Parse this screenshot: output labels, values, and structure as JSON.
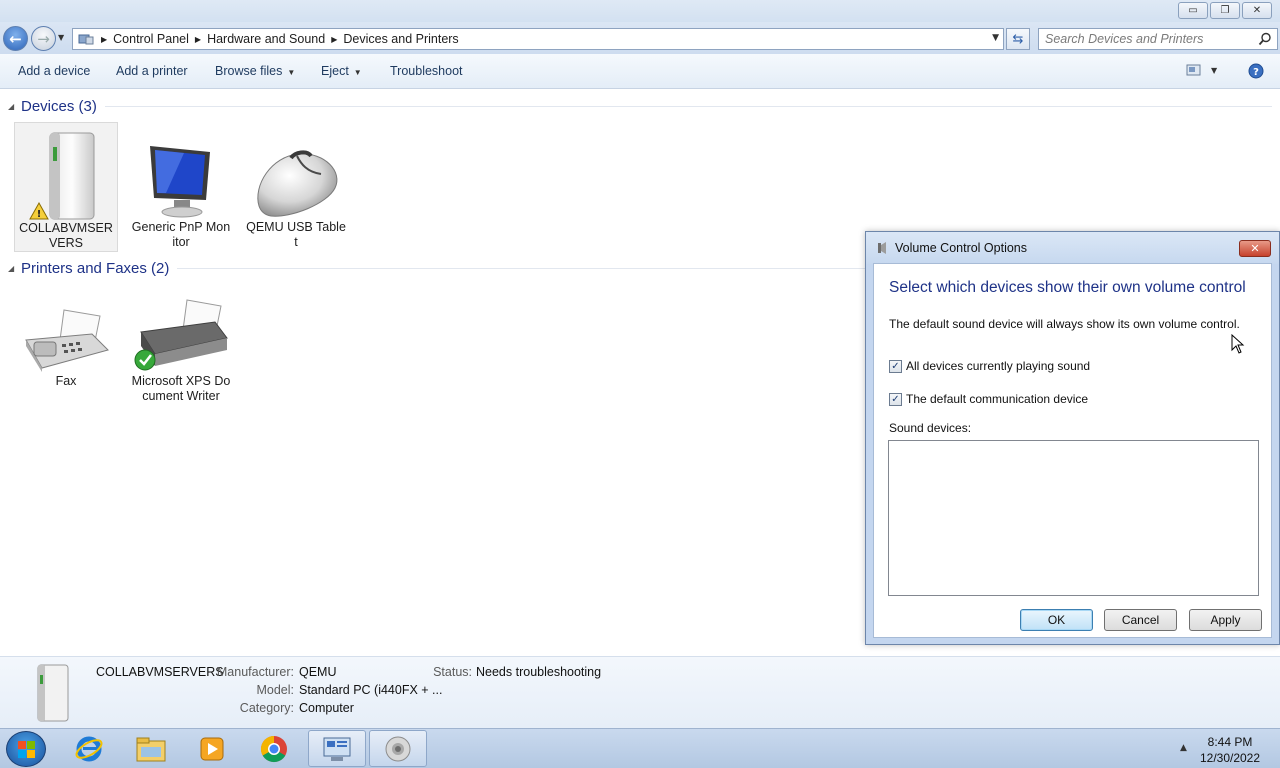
{
  "window": {
    "controls": {
      "minimize": "▭",
      "restore": "❐",
      "close": "✕"
    }
  },
  "navigation": {
    "breadcrumbs": [
      "Control Panel",
      "Hardware and Sound",
      "Devices and Printers"
    ],
    "search_placeholder": "Search Devices and Printers"
  },
  "toolbar": {
    "add_device": "Add a device",
    "add_printer": "Add a printer",
    "browse_files": "Browse files",
    "eject": "Eject",
    "troubleshoot": "Troubleshoot"
  },
  "groups": {
    "devices": {
      "title": "Devices (3)",
      "items": [
        {
          "label": "COLLABVMSERVERS",
          "icon": "computer-icon",
          "warning": true
        },
        {
          "label": "Generic PnP Monitor",
          "icon": "monitor-icon"
        },
        {
          "label": "QEMU USB Tablet",
          "icon": "mouse-icon"
        }
      ]
    },
    "printers": {
      "title": "Printers and Faxes (2)",
      "items": [
        {
          "label": "Fax",
          "icon": "fax-icon"
        },
        {
          "label": "Microsoft XPS Document Writer",
          "icon": "printer-icon",
          "default": true
        }
      ]
    }
  },
  "details": {
    "name": "COLLABVMSERVERS",
    "manufacturer_key": "Manufacturer:",
    "manufacturer": "QEMU",
    "model_key": "Model:",
    "model": "Standard PC (i440FX + ...",
    "category_key": "Category:",
    "category": "Computer",
    "status_key": "Status:",
    "status": "Needs troubleshooting"
  },
  "dialog": {
    "title": "Volume Control Options",
    "heading": "Select which devices show their own volume control",
    "description": "The default sound device will always show its own volume control.",
    "checkbox_playing": "All devices currently playing sound",
    "checkbox_playing_checked": true,
    "checkbox_comm": "The default communication device",
    "checkbox_comm_checked": true,
    "sound_devices_label": "Sound devices:",
    "sound_devices": [],
    "ok": "OK",
    "cancel": "Cancel",
    "apply": "Apply"
  },
  "taskbar": {
    "apps": [
      "start-button",
      "internet-explorer-icon",
      "file-explorer-icon",
      "media-player-icon",
      "chrome-icon",
      "devices-and-printers-icon",
      "volume-icon"
    ],
    "time": "8:44 PM",
    "date": "12/30/2022"
  },
  "colors": {
    "group_title": "#1e3287",
    "toolbar_text": "#1e3a5f",
    "accent": "#2d64b8"
  }
}
